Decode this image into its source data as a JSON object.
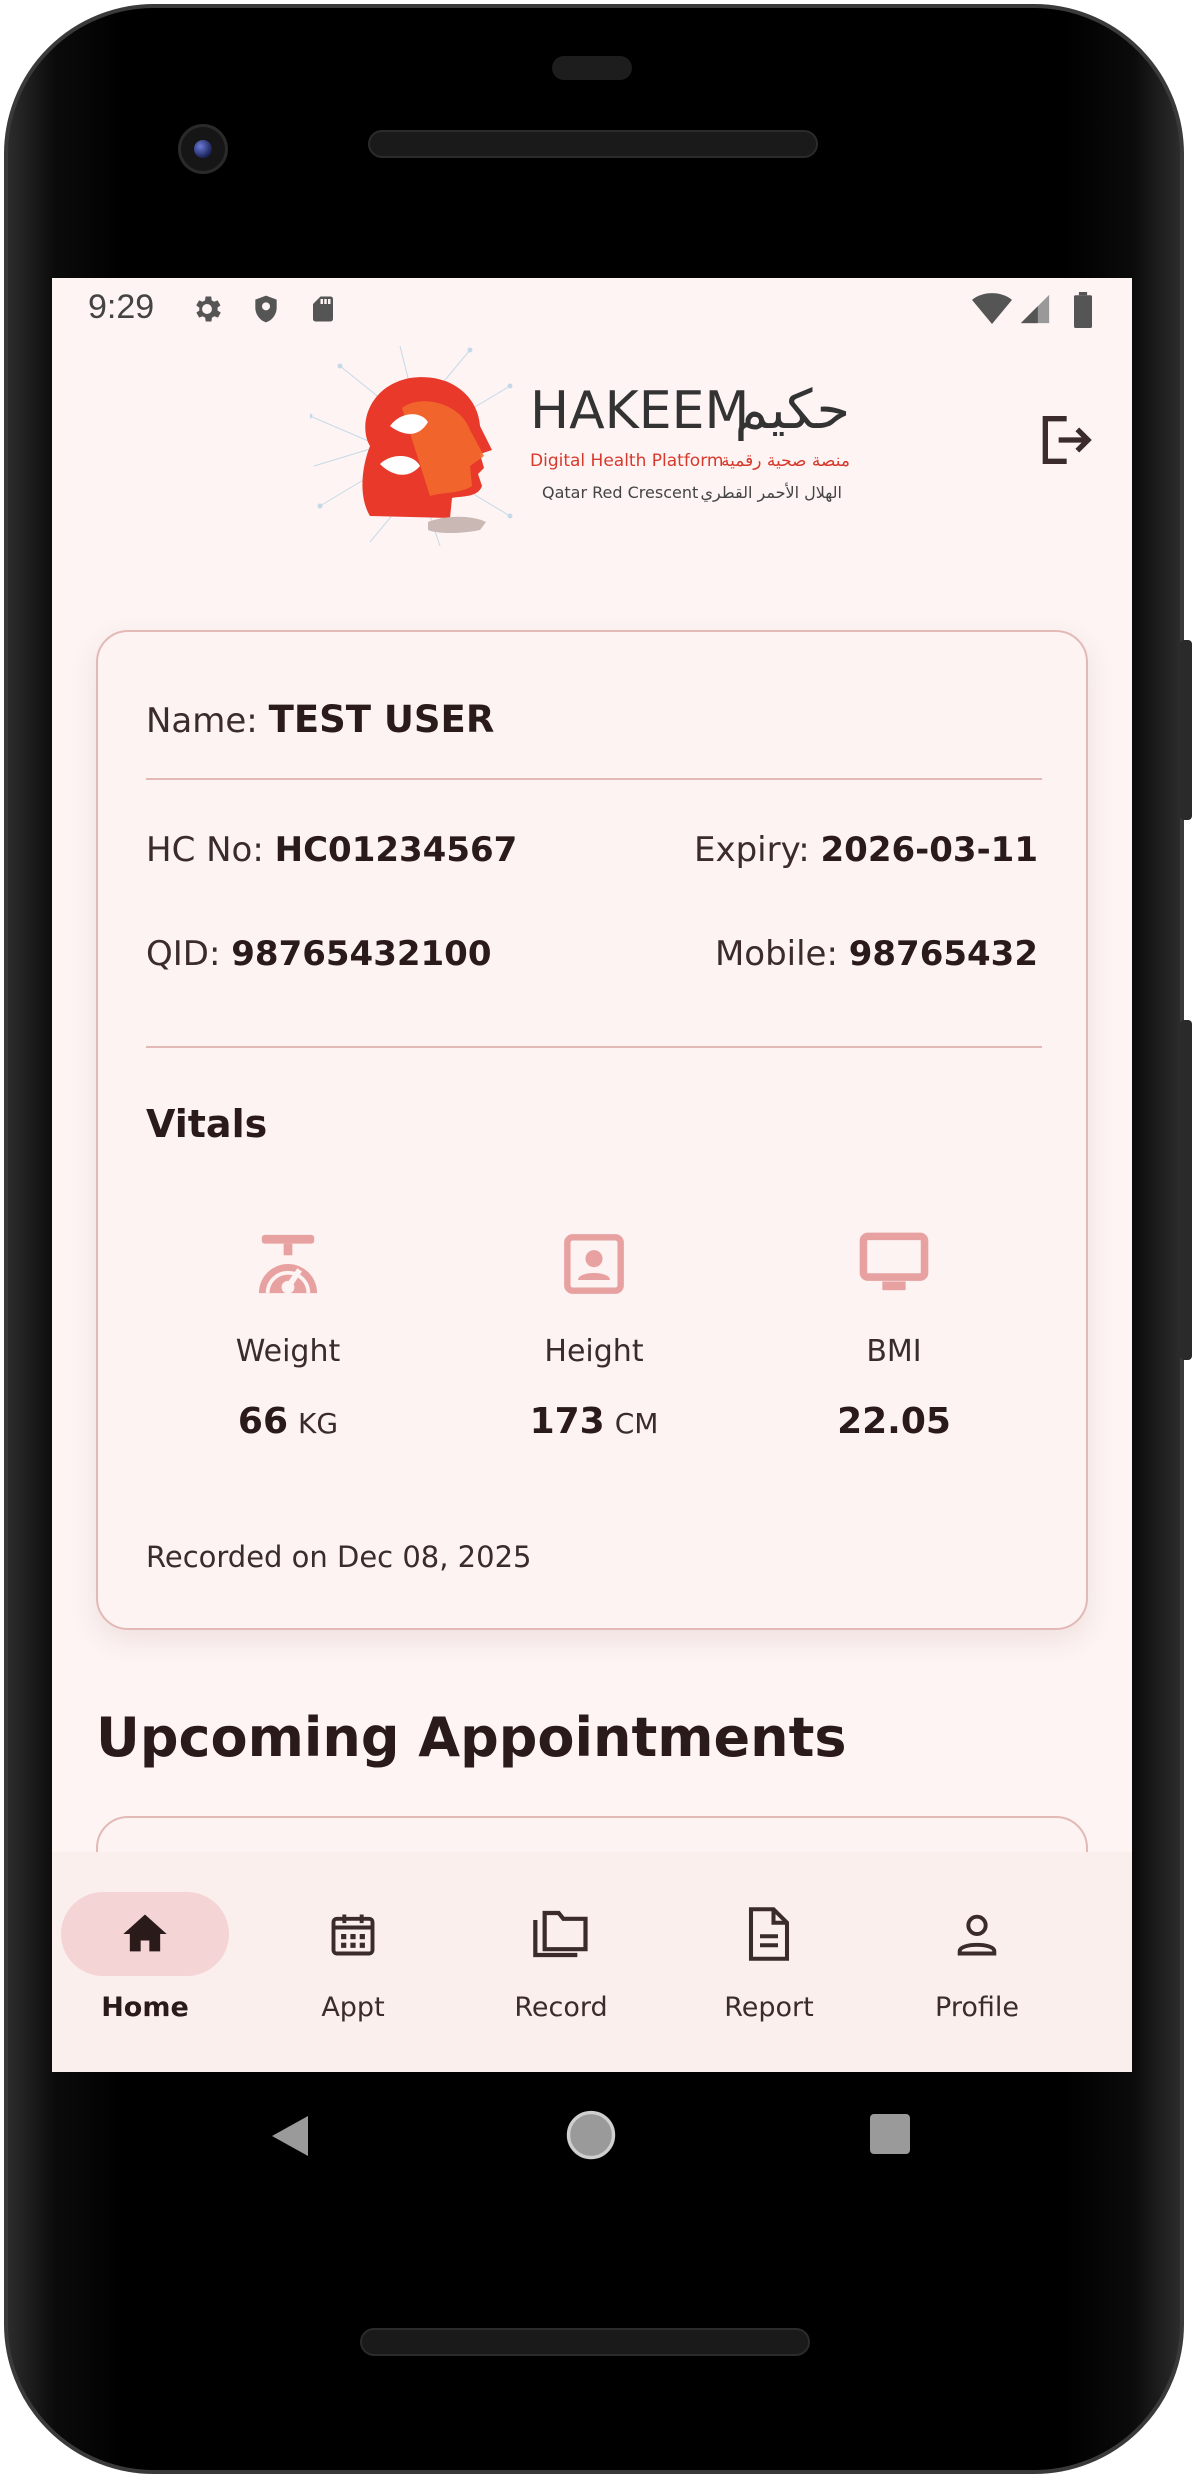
{
  "status_bar": {
    "time": "9:29",
    "left_icons": [
      "gear-icon",
      "shield-icon",
      "sd-card-icon"
    ],
    "right_icons": [
      "wifi-icon",
      "signal-icon",
      "battery-icon"
    ]
  },
  "header": {
    "logo": {
      "brand_en": "HAKEEM",
      "brand_ar": "حكيم",
      "tagline_en": "Digital Health Platform",
      "tagline_ar": "منصة صحية رقمية",
      "org_en": "Qatar Red Crescent",
      "org_ar": "الهلال الأحمر القطري"
    },
    "logout_icon": "logout-icon"
  },
  "patient": {
    "name_label": "Name:",
    "name_value": "TEST USER",
    "hc_label": "HC No:",
    "hc_value": "HC01234567",
    "expiry_label": "Expiry:",
    "expiry_value": "2026-03-11",
    "qid_label": "QID:",
    "qid_value": "98765432100",
    "mobile_label": "Mobile:",
    "mobile_value": "98765432"
  },
  "vitals": {
    "title": "Vitals",
    "items": [
      {
        "icon": "scale-icon",
        "label": "Weight",
        "value": "66",
        "unit": "KG"
      },
      {
        "icon": "portrait-icon",
        "label": "Height",
        "value": "173",
        "unit": "CM"
      },
      {
        "icon": "monitor-icon",
        "label": "BMI",
        "value": "22.05",
        "unit": ""
      }
    ],
    "recorded": "Recorded on Dec 08, 2025"
  },
  "upcoming": {
    "title": "Upcoming Appointments"
  },
  "bottom_nav": {
    "items": [
      {
        "label": "Home",
        "icon": "home-icon",
        "active": true
      },
      {
        "label": "Appt",
        "icon": "calendar-icon",
        "active": false
      },
      {
        "label": "Record",
        "icon": "folder-icon",
        "active": false
      },
      {
        "label": "Report",
        "icon": "document-icon",
        "active": false
      },
      {
        "label": "Profile",
        "icon": "person-icon",
        "active": false
      }
    ]
  },
  "colors": {
    "screen_bg": "#fdf4f3",
    "card_border": "#e3b9b6",
    "accent_pink": "#e8a1a1",
    "nav_active_pill": "#f4d4d4",
    "text_dark": "#2a1a1a"
  }
}
